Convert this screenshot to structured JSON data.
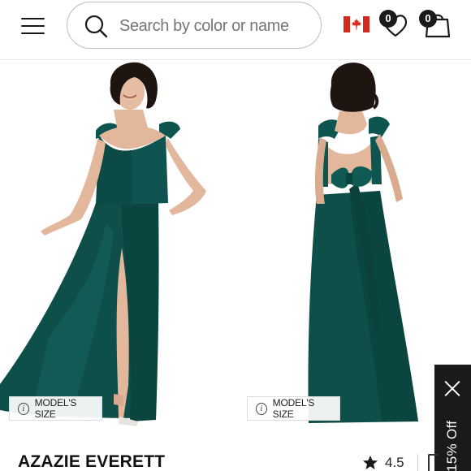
{
  "header": {
    "search": {
      "placeholder": "Search by color or name",
      "value": ""
    },
    "wishlist_count": "0",
    "cart_count": "0",
    "icons": {
      "menu": "hamburger-menu-icon",
      "search": "search-icon",
      "flag": "canada-flag-icon",
      "wishlist": "heart-icon",
      "cart": "shopping-bag-icon"
    }
  },
  "gallery": {
    "images": [
      {
        "alt": "Front view of teal gown"
      },
      {
        "alt": "Back view of teal gown"
      }
    ],
    "model_size_label": "MODEL'S SIZE"
  },
  "promo": {
    "text": "15% Off"
  },
  "product": {
    "title": "AZAZIE EVERETT",
    "rating": "4.5"
  },
  "colors": {
    "dress": "#0e4f4a",
    "dress_dark": "#083a36",
    "dress_light": "#1b6a62",
    "promo_bg": "#1a1a1a",
    "flag_red": "#d52b1e"
  }
}
